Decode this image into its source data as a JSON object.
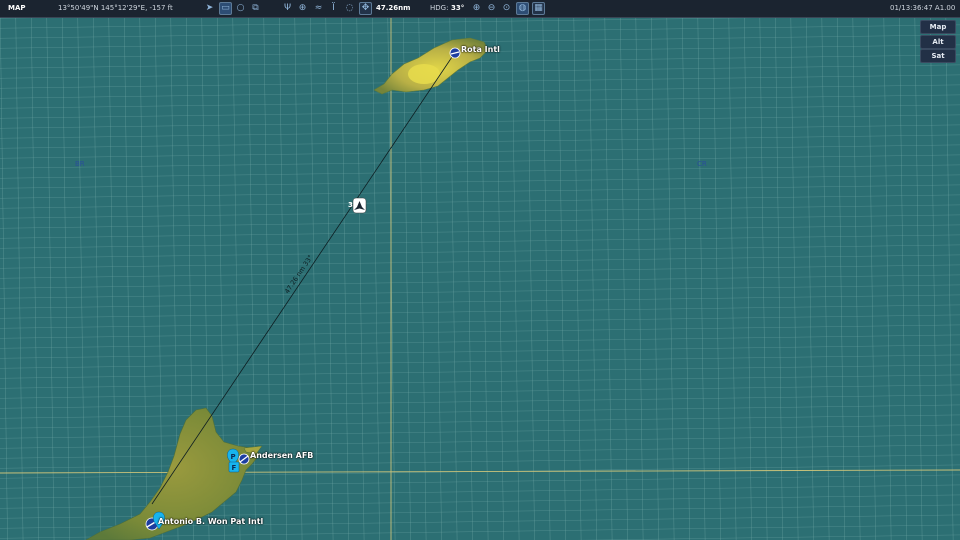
{
  "toolbar": {
    "mode": "MAP",
    "coords": "13°50'49\"N 145°12'29\"E, -157 ft",
    "distance": "47.26nm",
    "heading_label": "HDG:",
    "heading_value": "33°",
    "clock": "01/13:36:47 A1.00",
    "icons": [
      "navigate-icon",
      "ruler-icon",
      "circle-icon",
      "layers-icon",
      "antenna-icon",
      "crosshair-icon",
      "wifi-icon",
      "tower-icon",
      "chat-icon",
      "move-icon",
      "zoom-in-icon",
      "zoom-out-icon",
      "zoom-reset-icon",
      "globe-icon",
      "grid-icon"
    ]
  },
  "map_modes": [
    "Map",
    "Alt",
    "Sat"
  ],
  "airports": [
    {
      "name": "Rota Intl"
    },
    {
      "name": "Andersen AFB"
    },
    {
      "name": "Antonio B. Won Pat Intl"
    }
  ],
  "route": {
    "label": "47.26 nm 33°"
  },
  "markers": {
    "aircraft_label": "3",
    "parking_letters": [
      "P",
      "F"
    ]
  },
  "sectors": [
    "BR",
    "CR"
  ],
  "colors": {
    "sea": "#2c6f73",
    "grid": "#7fb2b0",
    "land": "#7b8a37",
    "land_high": "#d8cf4c",
    "toolbar_bg": "#1b2430"
  }
}
